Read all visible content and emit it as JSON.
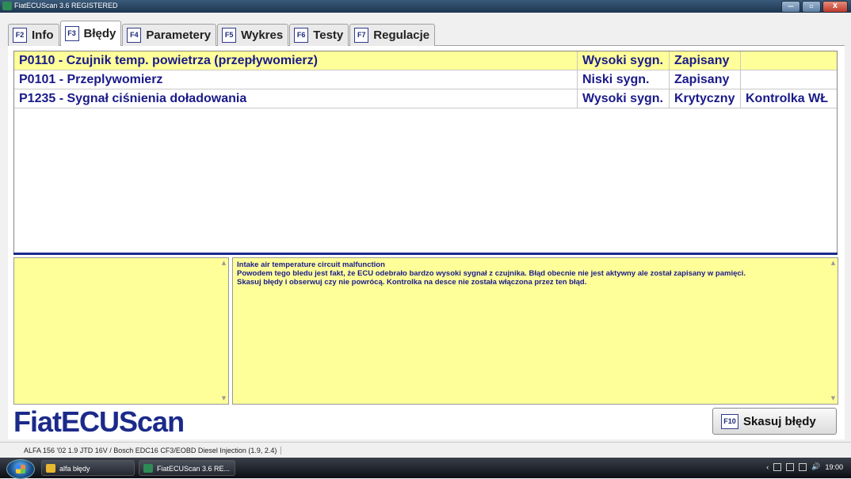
{
  "window": {
    "title": "FiatECUScan 3.6 REGISTERED",
    "minimize": "—",
    "maximize": "▫",
    "close": "X"
  },
  "tabs": [
    {
      "key": "F2",
      "label": "Info"
    },
    {
      "key": "F3",
      "label": "Błędy"
    },
    {
      "key": "F4",
      "label": "Parametery"
    },
    {
      "key": "F5",
      "label": "Wykres"
    },
    {
      "key": "F6",
      "label": "Testy"
    },
    {
      "key": "F7",
      "label": "Regulacje"
    }
  ],
  "faults": [
    {
      "code": "P0110 - Czujnik temp. powietrza (przepływomierz)",
      "signal": "Wysoki sygn.",
      "status": "Zapisany",
      "lamp": ""
    },
    {
      "code": "P0101 - Przeplywomierz",
      "signal": "Niski sygn.",
      "status": "Zapisany",
      "lamp": ""
    },
    {
      "code": "P1235 - Sygnał ciśnienia doładowania",
      "signal": "Wysoki sygn.",
      "status": "Krytyczny",
      "lamp": "Kontrolka WŁ"
    }
  ],
  "description": {
    "line1": "Intake air temperature circuit malfunction",
    "line2": "Powodem tego bledu jest fakt, że ECU odebrało bardzo wysoki sygnał z czujnika. Błąd obecnie nie jest aktywny ale został zapisany w pamięci.",
    "line3": "Skasuj błędy i obserwuj czy nie powrócą. Kontrolka na desce nie została włączona przez ten błąd."
  },
  "logo": "FiatECUScan",
  "clear_button": {
    "key": "F10",
    "label": "Skasuj błędy"
  },
  "status": "ALFA 156 '02 1.9 JTD 16V / Bosch EDC16 CF3/EOBD Diesel Injection (1.9, 2.4)",
  "taskbar": {
    "items": [
      "alfa błędy",
      "FiatECUScan 3.6 RE..."
    ],
    "clock": "19:00"
  },
  "colors": {
    "accent": "#1b2a8a",
    "highlight": "#ffff99"
  }
}
